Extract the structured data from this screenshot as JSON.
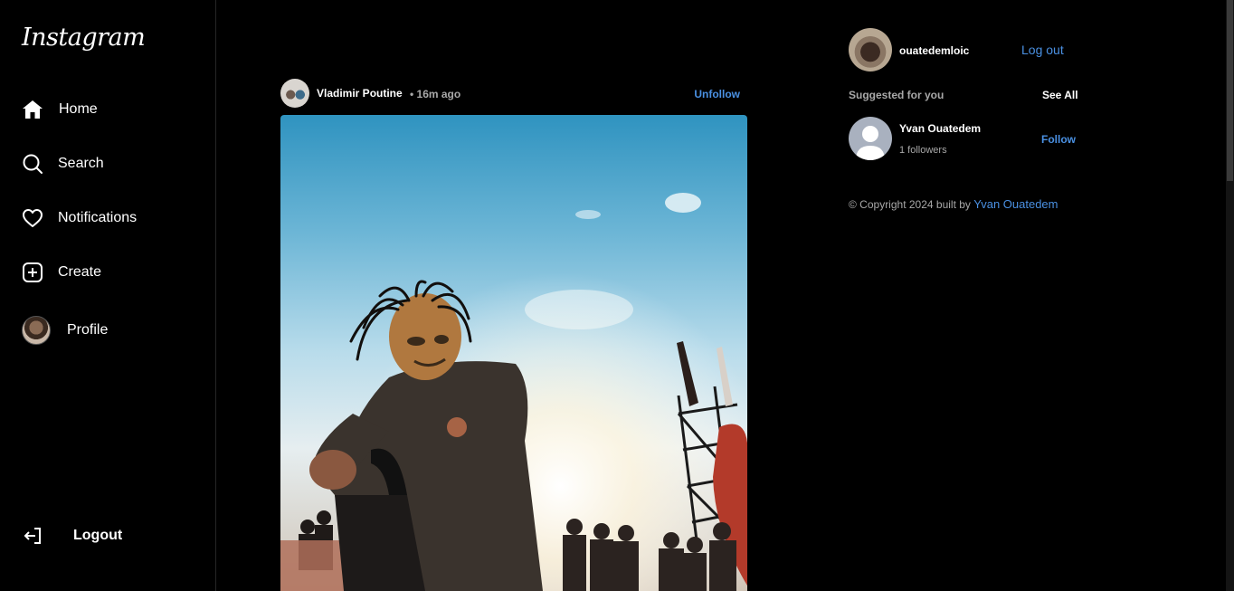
{
  "sidebar": {
    "logo": "Instagram",
    "items": [
      {
        "label": "Home",
        "icon": "home-icon"
      },
      {
        "label": "Search",
        "icon": "search-icon"
      },
      {
        "label": "Notifications",
        "icon": "heart-icon"
      },
      {
        "label": "Create",
        "icon": "plus-square-icon"
      },
      {
        "label": "Profile",
        "icon": "avatar"
      }
    ],
    "logout": {
      "label": "Logout",
      "icon": "logout-icon"
    }
  },
  "post": {
    "username": "Vladimir Poutine",
    "time": "• 16m ago",
    "action": "Unfollow"
  },
  "right_panel": {
    "username": "ouatedemloic",
    "logout": "Log out",
    "suggested_title": "Suggested for you",
    "see_all": "See All",
    "suggestions": [
      {
        "name": "Yvan Ouatedem",
        "followers": "1 followers",
        "action": "Follow"
      }
    ],
    "copyright_prefix": "© Copyright 2024 built by",
    "copyright_author": "Yvan Ouatedem"
  },
  "colors": {
    "background": "#000000",
    "link": "#4a90e2",
    "muted": "#a8a8a8"
  }
}
